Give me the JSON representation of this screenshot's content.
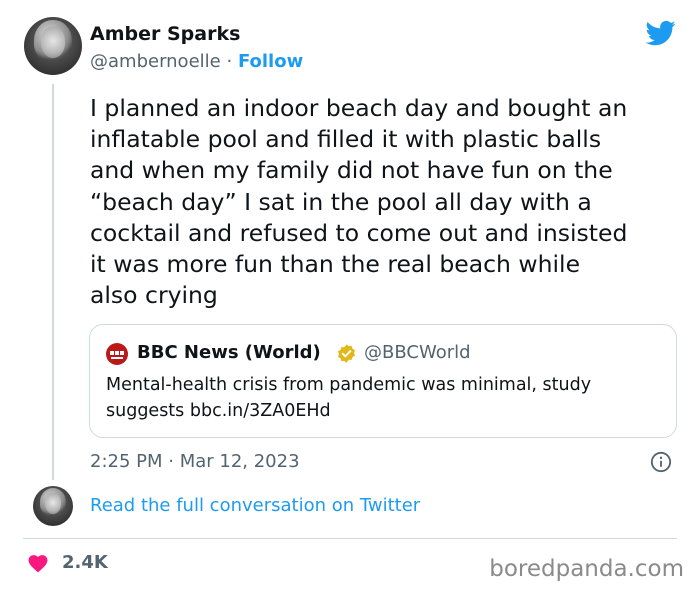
{
  "tweet": {
    "author": {
      "name": "Amber Sparks",
      "handle": "@ambernoelle",
      "separator": "·",
      "follow_label": "Follow",
      "avatar_icon": "profile-photo"
    },
    "platform_icon": "twitter-bird-icon",
    "text_lines": [
      "I planned an indoor beach day and bought an",
      "inflatable pool and filled it with plastic balls",
      "and when my family did not have fun on the",
      "“beach day” I sat in the pool all day with a",
      "cocktail and refused to come out and insisted",
      "it was more fun than the real beach while",
      "also crying"
    ],
    "quote": {
      "name": "BBC News (World)",
      "handle": "@BBCWorld",
      "logo_icon": "bbc-news-logo",
      "verified_icon": "verified-badge-icon",
      "text_lines": [
        "Mental-health crisis from pandemic was minimal, study",
        "suggests bbc.in/3ZA0EHd"
      ]
    },
    "timestamp": "2:25 PM · Mar 12, 2023",
    "info_icon": "info-icon",
    "read_more_label": "Read the full conversation on Twitter",
    "likes": "2.4K",
    "like_icon": "heart-icon"
  },
  "watermark": "boredpanda.com",
  "colors": {
    "accent": "#1d9bf0",
    "text": "#0f1419",
    "secondary": "#536471",
    "heart": "#f91880",
    "verified": "#e2b719",
    "bbc_red": "#bb1919",
    "border": "#cfd9de"
  }
}
